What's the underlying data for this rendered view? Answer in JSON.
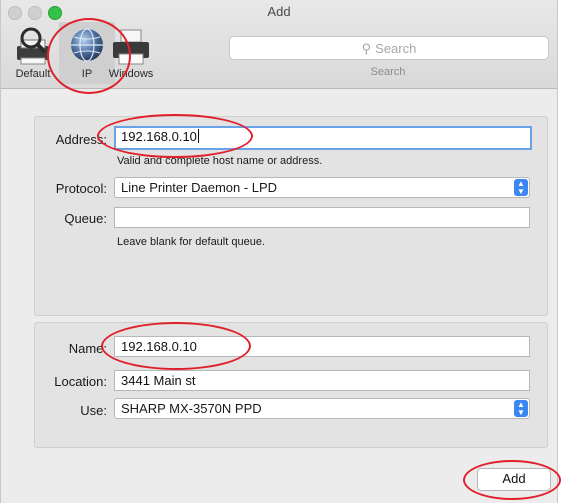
{
  "window": {
    "title": "Add"
  },
  "toolbar": {
    "items": [
      {
        "label": "Default",
        "icon": "magnifier-printer-icon"
      },
      {
        "label": "IP",
        "icon": "globe-icon"
      },
      {
        "label": "Windows",
        "icon": "printer-icon"
      }
    ],
    "selected": "IP",
    "search": {
      "placeholder": "Search",
      "caption": "Search"
    }
  },
  "form": {
    "address": {
      "label": "Address:",
      "value": "192.168.0.10",
      "hint": "Valid and complete host name or address."
    },
    "protocol": {
      "label": "Protocol:",
      "value": "Line Printer Daemon - LPD"
    },
    "queue": {
      "label": "Queue:",
      "value": "",
      "hint": "Leave blank for default queue."
    },
    "name": {
      "label": "Name:",
      "value": "192.168.0.10"
    },
    "location": {
      "label": "Location:",
      "value": "3441 Main st"
    },
    "use": {
      "label": "Use:",
      "value": "SHARP MX-3570N PPD"
    }
  },
  "buttons": {
    "add": "Add"
  },
  "colors": {
    "annotation": "#e0212b",
    "focus": "#6aa2e8",
    "stepper": "#3a86f5"
  }
}
